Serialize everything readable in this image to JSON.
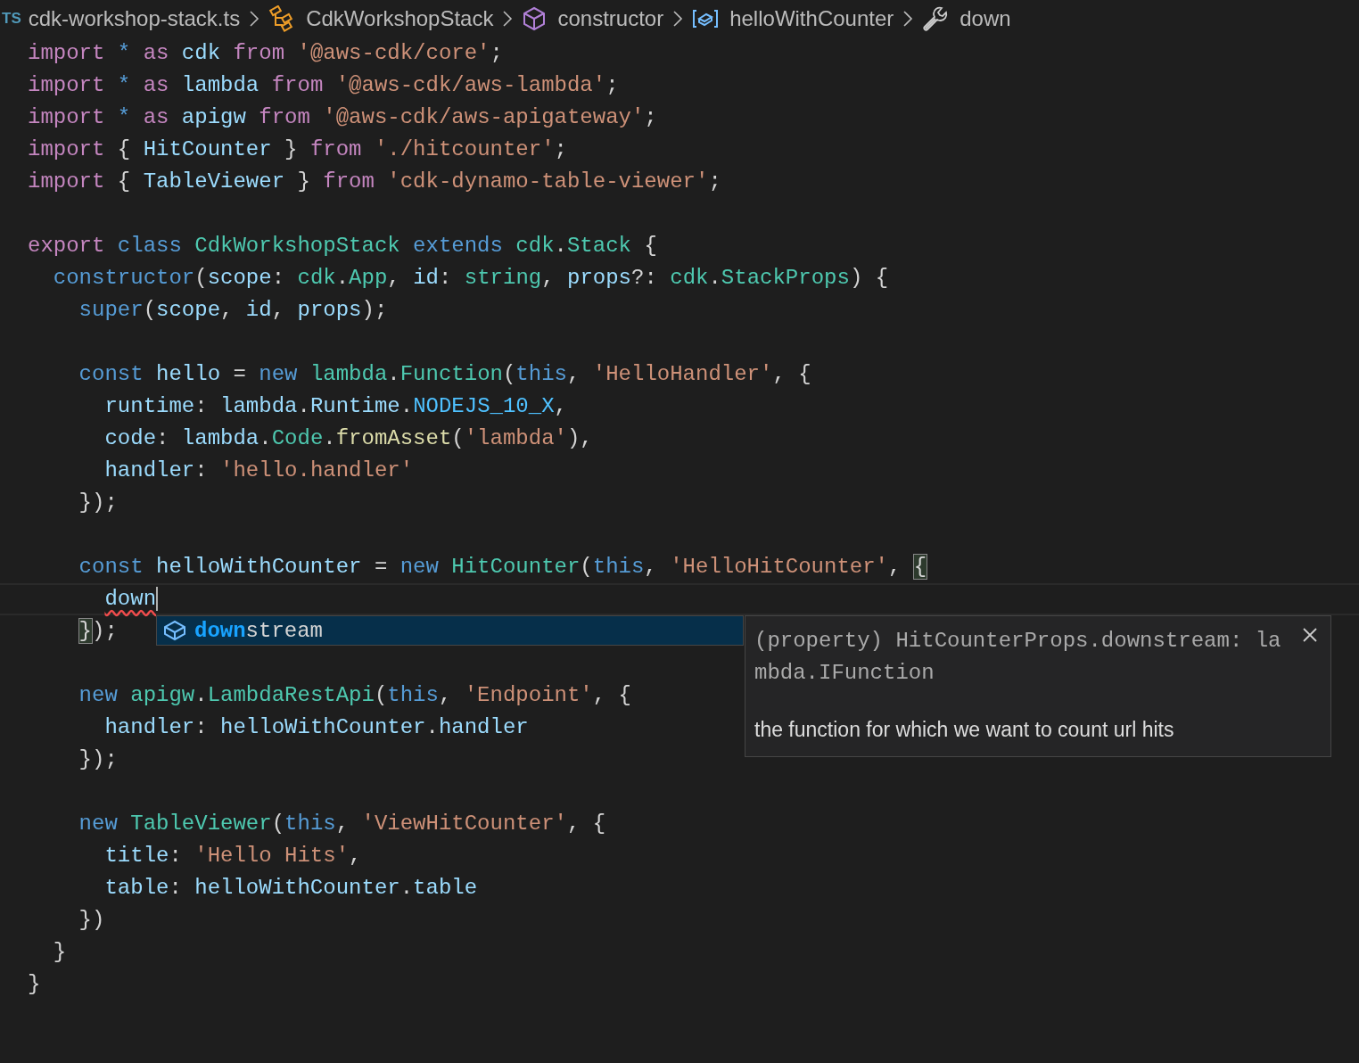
{
  "breadcrumb": [
    {
      "kind": "file",
      "badge": "TS",
      "label": "cdk-workshop-stack.ts"
    },
    {
      "kind": "class",
      "label": "CdkWorkshopStack"
    },
    {
      "kind": "method",
      "label": "constructor"
    },
    {
      "kind": "variable",
      "label": "helloWithCounter"
    },
    {
      "kind": "property",
      "label": "down"
    }
  ],
  "lines": [
    {
      "kind": "code",
      "tokens": [
        {
          "t": "import",
          "kind": "kw"
        },
        {
          "t": " * ",
          "kind": "st"
        },
        {
          "t": "as",
          "kind": "kw"
        },
        {
          "t": " cdk ",
          "kind": "v"
        },
        {
          "t": "from",
          "kind": "kw"
        },
        {
          "t": " '@aws-cdk/core'",
          "kind": "s"
        },
        {
          "t": ";",
          "kind": "p"
        }
      ]
    },
    {
      "kind": "code",
      "tokens": [
        {
          "t": "import",
          "kind": "kw"
        },
        {
          "t": " * ",
          "kind": "st"
        },
        {
          "t": "as",
          "kind": "kw"
        },
        {
          "t": " lambda ",
          "kind": "v"
        },
        {
          "t": "from",
          "kind": "kw"
        },
        {
          "t": " '@aws-cdk/aws-lambda'",
          "kind": "s"
        },
        {
          "t": ";",
          "kind": "p"
        }
      ]
    },
    {
      "kind": "code",
      "tokens": [
        {
          "t": "import",
          "kind": "kw"
        },
        {
          "t": " * ",
          "kind": "st"
        },
        {
          "t": "as",
          "kind": "kw"
        },
        {
          "t": " apigw ",
          "kind": "v"
        },
        {
          "t": "from",
          "kind": "kw"
        },
        {
          "t": " '@aws-cdk/aws-apigateway'",
          "kind": "s"
        },
        {
          "t": ";",
          "kind": "p"
        }
      ]
    },
    {
      "kind": "code",
      "tokens": [
        {
          "t": "import",
          "kind": "kw"
        },
        {
          "t": " { ",
          "kind": "p"
        },
        {
          "t": "HitCounter",
          "kind": "v"
        },
        {
          "t": " } ",
          "kind": "p"
        },
        {
          "t": "from",
          "kind": "kw"
        },
        {
          "t": " './hitcounter'",
          "kind": "s"
        },
        {
          "t": ";",
          "kind": "p"
        }
      ]
    },
    {
      "kind": "code",
      "tokens": [
        {
          "t": "import",
          "kind": "kw"
        },
        {
          "t": " { ",
          "kind": "p"
        },
        {
          "t": "TableViewer",
          "kind": "v"
        },
        {
          "t": " } ",
          "kind": "p"
        },
        {
          "t": "from",
          "kind": "kw"
        },
        {
          "t": " 'cdk-dynamo-table-viewer'",
          "kind": "s"
        },
        {
          "t": ";",
          "kind": "p"
        }
      ]
    },
    {
      "kind": "blank"
    },
    {
      "kind": "code",
      "tokens": [
        {
          "t": "export",
          "kind": "kw"
        },
        {
          "t": " class",
          "kind": "st"
        },
        {
          "t": " CdkWorkshopStack ",
          "kind": "c"
        },
        {
          "t": "extends",
          "kind": "st"
        },
        {
          "t": " cdk",
          "kind": "c"
        },
        {
          "t": ".",
          "kind": "p"
        },
        {
          "t": "Stack",
          "kind": "c"
        },
        {
          "t": " {",
          "kind": "p"
        }
      ]
    },
    {
      "kind": "code",
      "tokens": [
        {
          "t": "  constructor",
          "kind": "st"
        },
        {
          "t": "(",
          "kind": "p"
        },
        {
          "t": "scope",
          "kind": "v"
        },
        {
          "t": ": ",
          "kind": "p"
        },
        {
          "t": "cdk",
          "kind": "c"
        },
        {
          "t": ".",
          "kind": "p"
        },
        {
          "t": "App",
          "kind": "c"
        },
        {
          "t": ", ",
          "kind": "p"
        },
        {
          "t": "id",
          "kind": "v"
        },
        {
          "t": ": ",
          "kind": "p"
        },
        {
          "t": "string",
          "kind": "c"
        },
        {
          "t": ", ",
          "kind": "p"
        },
        {
          "t": "props",
          "kind": "v"
        },
        {
          "t": "?: ",
          "kind": "p"
        },
        {
          "t": "cdk",
          "kind": "c"
        },
        {
          "t": ".",
          "kind": "p"
        },
        {
          "t": "StackProps",
          "kind": "c"
        },
        {
          "t": ") {",
          "kind": "p"
        }
      ]
    },
    {
      "kind": "code",
      "tokens": [
        {
          "t": "    super",
          "kind": "st"
        },
        {
          "t": "(",
          "kind": "p"
        },
        {
          "t": "scope",
          "kind": "v"
        },
        {
          "t": ", ",
          "kind": "p"
        },
        {
          "t": "id",
          "kind": "v"
        },
        {
          "t": ", ",
          "kind": "p"
        },
        {
          "t": "props",
          "kind": "v"
        },
        {
          "t": ");",
          "kind": "p"
        }
      ]
    },
    {
      "kind": "blank"
    },
    {
      "kind": "code",
      "tokens": [
        {
          "t": "    const",
          "kind": "st"
        },
        {
          "t": " hello ",
          "kind": "v"
        },
        {
          "t": "= ",
          "kind": "p"
        },
        {
          "t": "new",
          "kind": "st"
        },
        {
          "t": " lambda",
          "kind": "c"
        },
        {
          "t": ".",
          "kind": "p"
        },
        {
          "t": "Function",
          "kind": "c"
        },
        {
          "t": "(",
          "kind": "p"
        },
        {
          "t": "this",
          "kind": "st"
        },
        {
          "t": ", ",
          "kind": "p"
        },
        {
          "t": "'HelloHandler'",
          "kind": "s"
        },
        {
          "t": ", {",
          "kind": "p"
        }
      ]
    },
    {
      "kind": "code",
      "tokens": [
        {
          "t": "      runtime",
          "kind": "v"
        },
        {
          "t": ": ",
          "kind": "p"
        },
        {
          "t": "lambda",
          "kind": "v"
        },
        {
          "t": ".",
          "kind": "p"
        },
        {
          "t": "Runtime",
          "kind": "v"
        },
        {
          "t": ".",
          "kind": "p"
        },
        {
          "t": "NODEJS_10_X",
          "kind": "k"
        },
        {
          "t": ",",
          "kind": "p"
        }
      ]
    },
    {
      "kind": "code",
      "tokens": [
        {
          "t": "      code",
          "kind": "v"
        },
        {
          "t": ": ",
          "kind": "p"
        },
        {
          "t": "lambda",
          "kind": "v"
        },
        {
          "t": ".",
          "kind": "p"
        },
        {
          "t": "Code",
          "kind": "c"
        },
        {
          "t": ".",
          "kind": "p"
        },
        {
          "t": "fromAsset",
          "kind": "f"
        },
        {
          "t": "(",
          "kind": "p"
        },
        {
          "t": "'lambda'",
          "kind": "s"
        },
        {
          "t": "),",
          "kind": "p"
        }
      ]
    },
    {
      "kind": "code",
      "tokens": [
        {
          "t": "      handler",
          "kind": "v"
        },
        {
          "t": ": ",
          "kind": "p"
        },
        {
          "t": "'hello.handler'",
          "kind": "s"
        }
      ]
    },
    {
      "kind": "code",
      "tokens": [
        {
          "t": "    });",
          "kind": "p"
        }
      ]
    },
    {
      "kind": "blank"
    },
    {
      "kind": "code",
      "tokens": [
        {
          "t": "    const",
          "kind": "st"
        },
        {
          "t": " helloWithCounter ",
          "kind": "v"
        },
        {
          "t": "= ",
          "kind": "p"
        },
        {
          "t": "new",
          "kind": "st"
        },
        {
          "t": " HitCounter",
          "kind": "c"
        },
        {
          "t": "(",
          "kind": "p"
        },
        {
          "t": "this",
          "kind": "st"
        },
        {
          "t": ", ",
          "kind": "p"
        },
        {
          "t": "'HelloHitCounter'",
          "kind": "s"
        },
        {
          "t": ",",
          "kind": "p"
        },
        {
          "t": " {",
          "kind": "p",
          "matched": true
        }
      ]
    },
    {
      "kind": "code",
      "current": true,
      "tokens": [
        {
          "t": "      down",
          "kind": "v",
          "error": true,
          "cursor": true
        }
      ]
    },
    {
      "kind": "code",
      "tokens": [
        {
          "t": "    }",
          "kind": "p",
          "matched": true
        },
        {
          "t": ");",
          "kind": "p"
        }
      ]
    },
    {
      "kind": "blank"
    },
    {
      "kind": "code",
      "tokens": [
        {
          "t": "    new",
          "kind": "st"
        },
        {
          "t": " apigw",
          "kind": "c"
        },
        {
          "t": ".",
          "kind": "p"
        },
        {
          "t": "LambdaRestApi",
          "kind": "c"
        },
        {
          "t": "(",
          "kind": "p"
        },
        {
          "t": "this",
          "kind": "st"
        },
        {
          "t": ", ",
          "kind": "p"
        },
        {
          "t": "'Endpoint'",
          "kind": "s"
        },
        {
          "t": ", {",
          "kind": "p"
        }
      ]
    },
    {
      "kind": "code",
      "tokens": [
        {
          "t": "      handler",
          "kind": "v"
        },
        {
          "t": ": ",
          "kind": "p"
        },
        {
          "t": "helloWithCounter",
          "kind": "v"
        },
        {
          "t": ".",
          "kind": "p"
        },
        {
          "t": "handler",
          "kind": "v"
        }
      ]
    },
    {
      "kind": "code",
      "tokens": [
        {
          "t": "    });",
          "kind": "p"
        }
      ]
    },
    {
      "kind": "blank"
    },
    {
      "kind": "code",
      "tokens": [
        {
          "t": "    new",
          "kind": "st"
        },
        {
          "t": " TableViewer",
          "kind": "c"
        },
        {
          "t": "(",
          "kind": "p"
        },
        {
          "t": "this",
          "kind": "st"
        },
        {
          "t": ", ",
          "kind": "p"
        },
        {
          "t": "'ViewHitCounter'",
          "kind": "s"
        },
        {
          "t": ", {",
          "kind": "p"
        }
      ]
    },
    {
      "kind": "code",
      "tokens": [
        {
          "t": "      title",
          "kind": "v"
        },
        {
          "t": ": ",
          "kind": "p"
        },
        {
          "t": "'Hello Hits'",
          "kind": "s"
        },
        {
          "t": ",",
          "kind": "p"
        }
      ]
    },
    {
      "kind": "code",
      "tokens": [
        {
          "t": "      table",
          "kind": "v"
        },
        {
          "t": ": ",
          "kind": "p"
        },
        {
          "t": "helloWithCounter",
          "kind": "v"
        },
        {
          "t": ".",
          "kind": "p"
        },
        {
          "t": "table",
          "kind": "v"
        }
      ]
    },
    {
      "kind": "code",
      "tokens": [
        {
          "t": "    })",
          "kind": "p"
        }
      ]
    },
    {
      "kind": "code",
      "tokens": [
        {
          "t": "  }",
          "kind": "p"
        }
      ]
    },
    {
      "kind": "code",
      "tokens": [
        {
          "t": "}",
          "kind": "p"
        }
      ]
    }
  ],
  "suggestions": [
    {
      "match": "down",
      "rest": "stream",
      "selected": true
    }
  ],
  "hover": {
    "signature": "(property) HitCounterProps.downstream: lambda.IFunction",
    "description": "the function for which we want to count url hits"
  }
}
